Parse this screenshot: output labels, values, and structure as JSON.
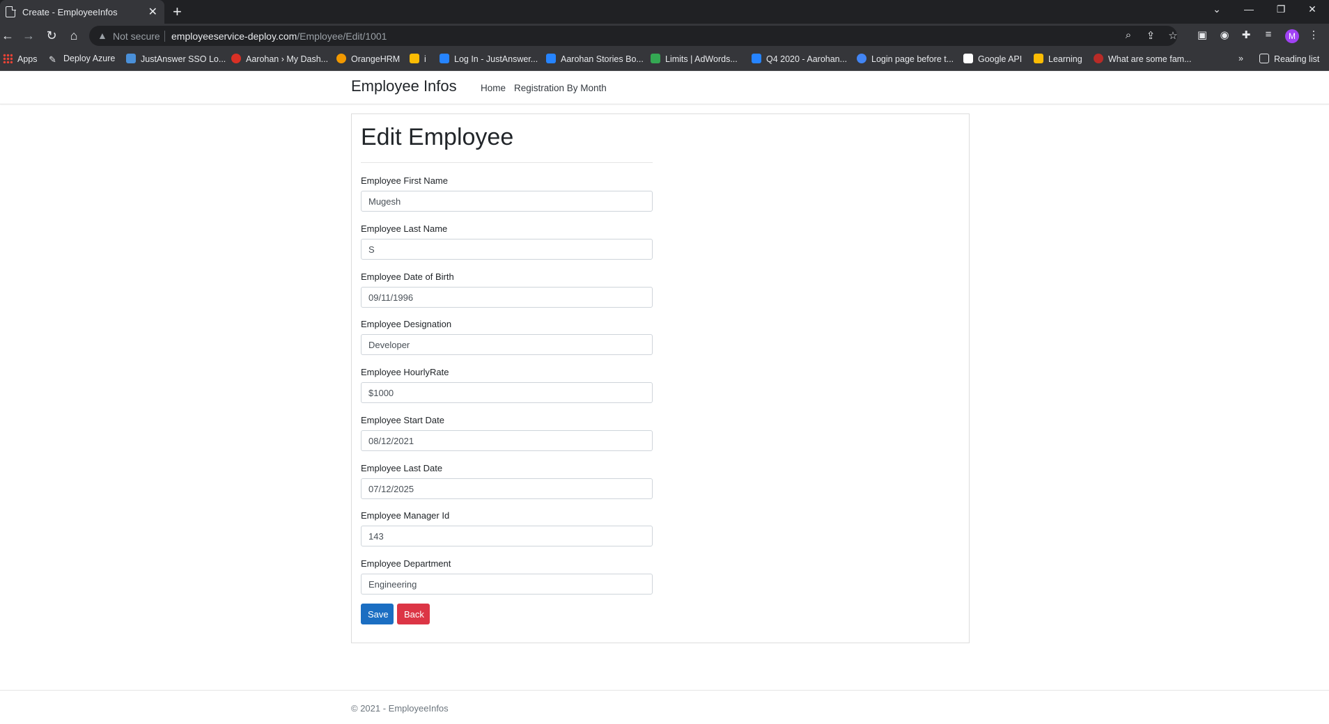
{
  "browser": {
    "tab_title": "Create - EmployeeInfos",
    "tab_close": "✕",
    "new_tab": "+",
    "not_secure": "Not secure",
    "url_host": "employeeservice-deploy.com",
    "url_path": "/Employee/Edit/1001",
    "avatar_letter": "M",
    "reading_list": "Reading list",
    "bookmarks": [
      {
        "label": "Apps",
        "color": "#ea4335"
      },
      {
        "label": "Deploy Azure",
        "color": "#e8eaed"
      },
      {
        "label": "JustAnswer SSO Lo...",
        "color": "#4a90d9"
      },
      {
        "label": "Aarohan › My Dash...",
        "color": "#d93025"
      },
      {
        "label": "OrangeHRM",
        "color": "#f29900"
      },
      {
        "label": "i",
        "color": "#fbbc04"
      },
      {
        "label": "Log In - JustAnswer...",
        "color": "#2684ff"
      },
      {
        "label": "Aarohan Stories Bo...",
        "color": "#2684ff"
      },
      {
        "label": "Limits | AdWords...",
        "color": "#34a853"
      },
      {
        "label": "Q4 2020 - Aarohan...",
        "color": "#2684ff"
      },
      {
        "label": "Login page before t...",
        "color": "#4285f4"
      },
      {
        "label": "Google API",
        "color": "#ffffff"
      },
      {
        "label": "Learning",
        "color": "#fbbc04"
      },
      {
        "label": "What are some fam...",
        "color": "#b92b27"
      }
    ]
  },
  "site": {
    "brand": "Employee Infos",
    "nav": [
      "Home",
      "Registration By Month"
    ],
    "footer": "© 2021 - EmployeeInfos"
  },
  "form": {
    "title": "Edit Employee",
    "fields": [
      {
        "label": "Employee First Name",
        "value": "Mugesh"
      },
      {
        "label": "Employee Last Name",
        "value": "S"
      },
      {
        "label": "Employee Date of Birth",
        "value": "09/11/1996"
      },
      {
        "label": "Employee Designation",
        "value": "Developer"
      },
      {
        "label": "Employee HourlyRate",
        "value": "$1000"
      },
      {
        "label": "Employee Start Date",
        "value": "08/12/2021"
      },
      {
        "label": "Employee Last Date",
        "value": "07/12/2025"
      },
      {
        "label": "Employee Manager Id",
        "value": "143"
      },
      {
        "label": "Employee Department",
        "value": "Engineering"
      }
    ],
    "save_label": "Save",
    "back_label": "Back"
  },
  "colors": {
    "save_button": "#1b6ec2",
    "back_button": "#dc3545",
    "chrome_dark": "#202124",
    "chrome_toolbar": "#35363a"
  }
}
